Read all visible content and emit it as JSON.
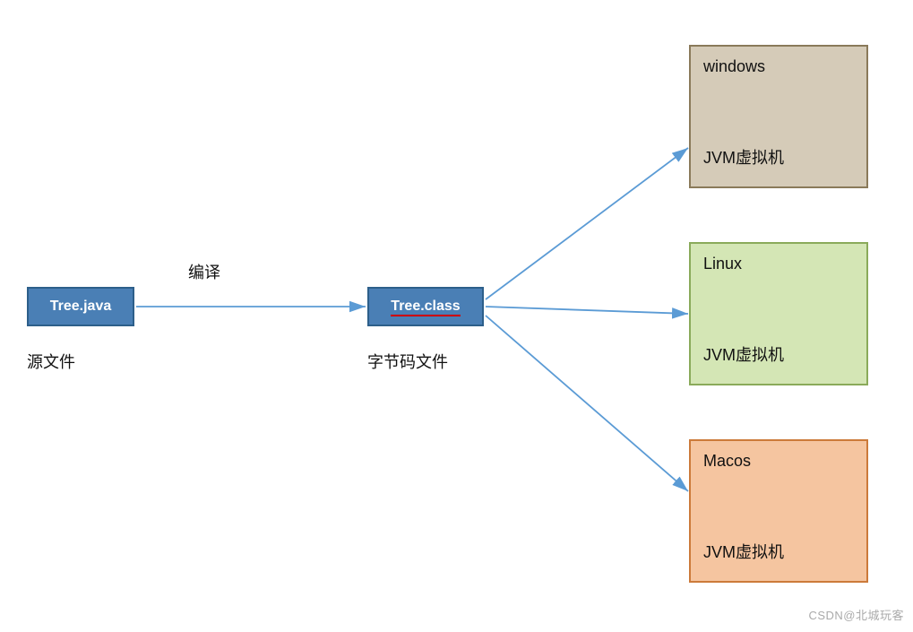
{
  "boxes": {
    "java": "Tree.java",
    "class": "Tree.class",
    "windows": "windows",
    "linux": "Linux",
    "macos": "Macos"
  },
  "labels": {
    "compile": "编译",
    "source": "源文件",
    "bytecode": "字节码文件",
    "jvm": "JVM虚拟机"
  },
  "watermark": "CSDN@北城玩客"
}
